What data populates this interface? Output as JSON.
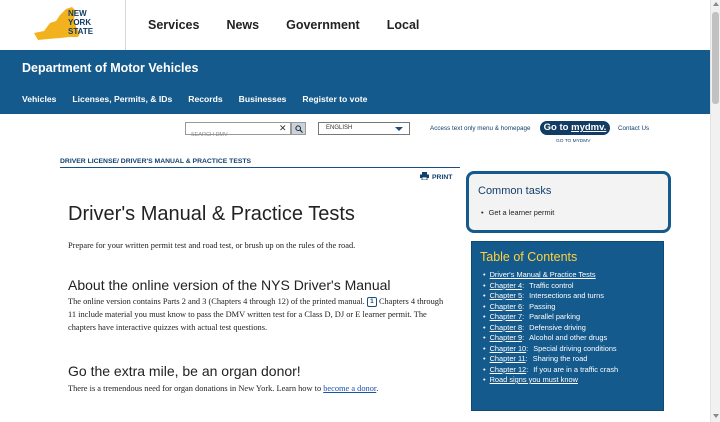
{
  "header": {
    "logo_text": [
      "NEW",
      "YORK",
      "STATE"
    ],
    "nav": [
      "Services",
      "News",
      "Government",
      "Local"
    ]
  },
  "banner": {
    "agency": "Department of Motor Vehicles",
    "subnav": [
      "Vehicles",
      "Licenses, Permits, & IDs",
      "Records",
      "Businesses",
      "Register to vote"
    ]
  },
  "utility": {
    "search_placeholder": "SEARCH DMV",
    "search_clear": "✕",
    "language": "ENGLISH",
    "access_link": "Access text only menu & homepage",
    "gotomydmv_prefix": "Go to ",
    "gotomydmv_brand": "mydmv.",
    "gotomydmv_sub": "GO TO MYDMV",
    "contact": "Contact Us"
  },
  "breadcrumb": {
    "parent": "DRIVER LICENSE",
    "current": "/ DRIVER'S MANUAL & PRACTICE TESTS"
  },
  "print_label": "PRINT",
  "main": {
    "title": "Driver's Manual & Practice Tests",
    "intro": "Prepare for your written permit test and road test, or brush up on the rules of the road.",
    "section1_heading": "About the online version of the NYS Driver's Manual",
    "section1_text_a": "The online version contains Parts 2 and 3 (Chapters 4 through 12) of the printed manual. ",
    "section1_footnote": "1",
    "section1_text_b": " Chapters 4 through 11 include material you must know to pass the DMV written test for a Class D, DJ or E learner permit. The chapters have interactive quizzes with actual test questions.",
    "section2_heading": "Go the extra mile, be an organ donor!",
    "section2_text": "There is a tremendous need for organ donations in New York.  Learn how to ",
    "section2_link": "become a donor",
    "section2_end": "."
  },
  "tasks": {
    "title": "Common tasks",
    "items": [
      "Get a learner permit"
    ]
  },
  "toc": {
    "title": "Table of Contents",
    "items": [
      {
        "link": "Driver's Manual & Practice Tests",
        "desc": ""
      },
      {
        "link": "Chapter 4",
        "desc": "Traffic control"
      },
      {
        "link": "Chapter 5",
        "desc": "Intersections and turns"
      },
      {
        "link": "Chapter 6",
        "desc": "Passing"
      },
      {
        "link": "Chapter 7",
        "desc": "Parallel parking"
      },
      {
        "link": "Chapter 8",
        "desc": "Defensive driving"
      },
      {
        "link": "Chapter 9",
        "desc": "Alcohol and other drugs"
      },
      {
        "link": "Chapter 10",
        "desc": "Special driving conditions"
      },
      {
        "link": "Chapter 11",
        "desc": "Sharing the road"
      },
      {
        "link": "Chapter 12",
        "desc": "If you are in a traffic crash"
      },
      {
        "link": "Road signs you must know",
        "desc": ""
      }
    ]
  },
  "colors": {
    "brand_blue": "#155a8c",
    "toc_title": "#ffd23f",
    "logo_yellow": "#f2b21d"
  }
}
